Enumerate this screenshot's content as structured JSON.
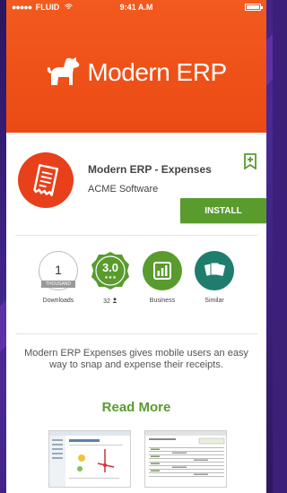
{
  "status_bar": {
    "carrier": "FLUID",
    "signal_dots": "●●●●●",
    "time": "9:41 A.M",
    "colors": {
      "text": "#ffffff"
    }
  },
  "header": {
    "brand_title": "Modern ERP",
    "logo_icon": "dog-icon",
    "color": "#ec4a14"
  },
  "app": {
    "name": "Modern ERP - Expenses",
    "developer": "ACME Software",
    "icon": "receipt-icon",
    "bookmark_icon": "bookmark-add-icon",
    "install_label": "INSTALL",
    "accent": "#5a9b2e"
  },
  "stats": [
    {
      "id": "downloads",
      "value": "1",
      "unit": "THOUSAND",
      "label": "Downloads"
    },
    {
      "id": "rating",
      "value": "3.0",
      "stars": "★★★",
      "label": "32",
      "label_icon": "person-icon"
    },
    {
      "id": "category",
      "icon": "chart-icon",
      "label": "Business"
    },
    {
      "id": "similar",
      "icon": "cards-icon",
      "label": "Similar"
    }
  ],
  "description": "Modern ERP Expenses gives mobile users an easy way to snap and expense their receipts.",
  "read_more_label": "Read More",
  "screenshots": [
    {
      "name": "screenshot-1"
    },
    {
      "name": "screenshot-2"
    }
  ]
}
